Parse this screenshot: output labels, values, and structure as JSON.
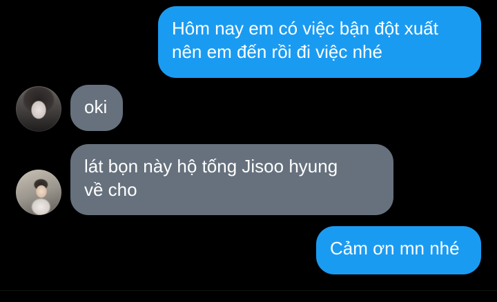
{
  "messages": [
    {
      "direction": "outgoing",
      "text": "Hôm nay em có việc bận đột xuất\nnên em đến rồi đi việc nhé"
    },
    {
      "direction": "incoming",
      "text": "oki"
    },
    {
      "direction": "incoming",
      "text": "lát bọn này hộ tống Jisoo hyung\nvề cho"
    },
    {
      "direction": "outgoing",
      "text": "Cảm ơn mn nhé"
    }
  ],
  "avatars": [
    {
      "icon": "profile-photo-icon"
    },
    {
      "icon": "profile-photo-icon"
    }
  ],
  "colors": {
    "background": "#000000",
    "outgoing_bubble": "#1a9bf2",
    "incoming_bubble": "#66717d",
    "text": "#ffffff"
  }
}
